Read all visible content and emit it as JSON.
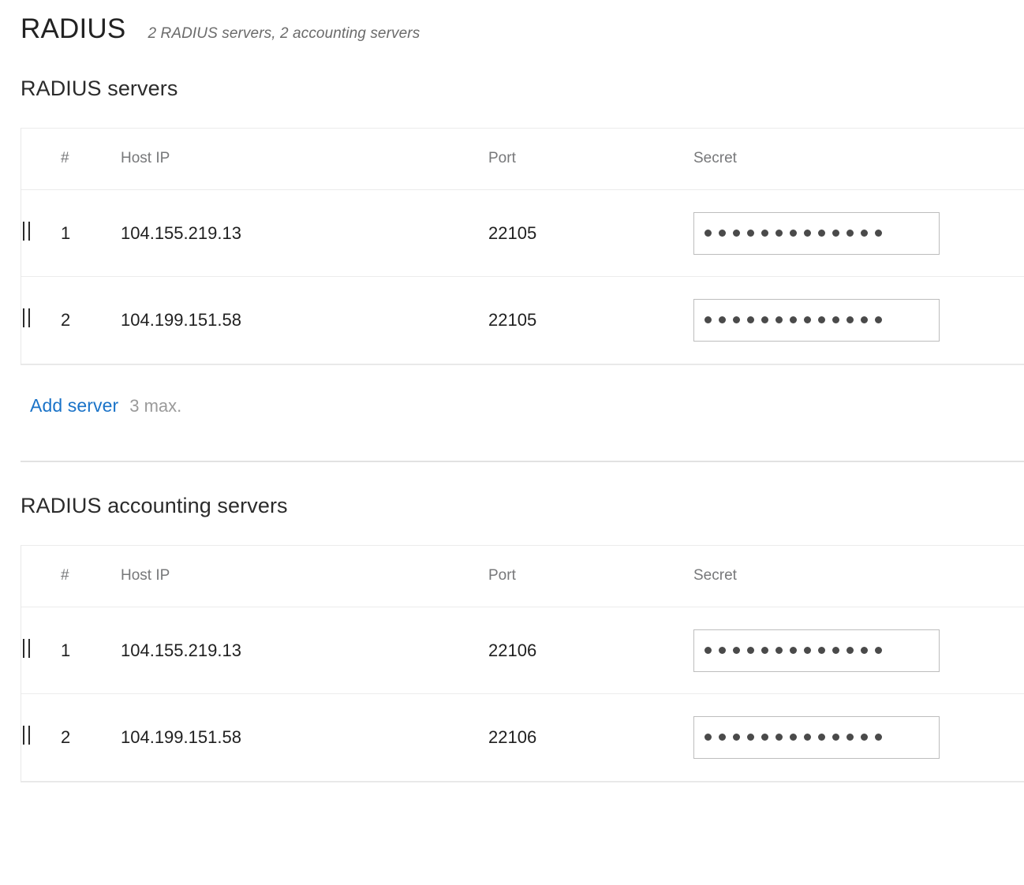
{
  "header": {
    "title": "RADIUS",
    "subtitle": "2 RADIUS servers, 2 accounting servers"
  },
  "columns": {
    "handle": "",
    "number": "#",
    "host_ip": "Host IP",
    "port": "Port",
    "secret": "Secret"
  },
  "sections": [
    {
      "heading": "RADIUS servers",
      "rows": [
        {
          "index": "1",
          "host_ip": "104.155.219.13",
          "port": "22105",
          "secret_dots": 13
        },
        {
          "index": "2",
          "host_ip": "104.199.151.58",
          "port": "22105",
          "secret_dots": 13
        }
      ],
      "add_link": "Add server",
      "add_note": "3 max."
    },
    {
      "heading": "RADIUS accounting servers",
      "rows": [
        {
          "index": "1",
          "host_ip": "104.155.219.13",
          "port": "22106",
          "secret_dots": 13
        },
        {
          "index": "2",
          "host_ip": "104.199.151.58",
          "port": "22106",
          "secret_dots": 13
        }
      ]
    }
  ],
  "colors": {
    "link": "#1a73c8",
    "title": "#222222",
    "muted": "#77787a",
    "border": "#ececec"
  }
}
